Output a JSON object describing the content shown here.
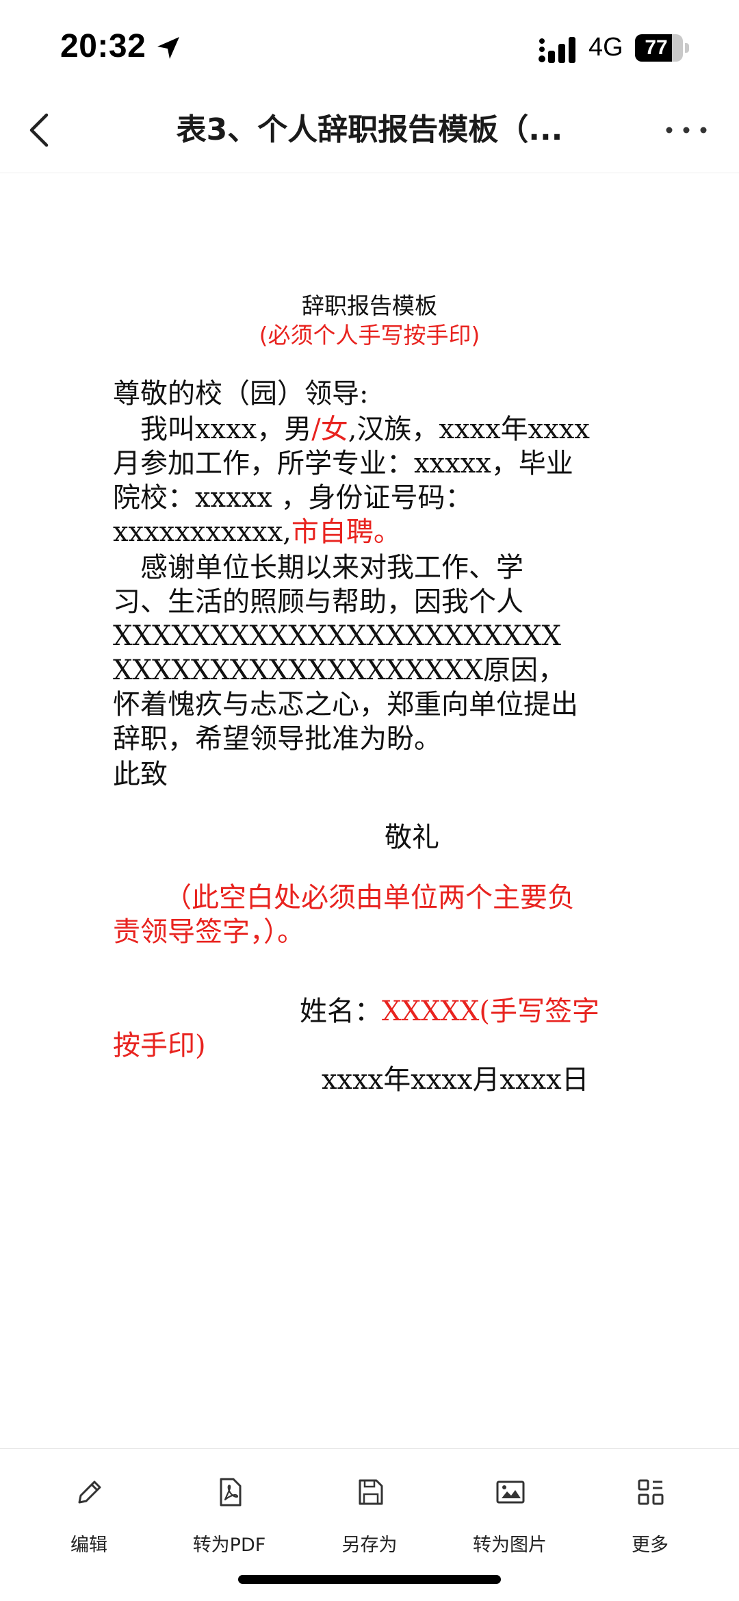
{
  "status_bar": {
    "time": "20:32",
    "network": "4G",
    "battery": "77",
    "battery_fraction": 0.77
  },
  "nav": {
    "title": "表3、个人辞职报告模板（...",
    "back_icon": "chevron-left-icon",
    "more_icon": "ellipsis-icon"
  },
  "document": {
    "title": "辞职报告模板",
    "title_note": "(必须个人手写按手印)",
    "salutation": "尊敬的校（园）领导:",
    "p1_l1_a": "　我叫xxxx，男",
    "p1_l1_b": "/女",
    "p1_l1_c": ",汉族，xxxx年xxxx",
    "p1_l2": "月参加工作，所学专业：xxxxx，毕业",
    "p1_l3": "院校：xxxxx ，身份证号码：",
    "p1_l4_a": "xxxxxxxxxxx,",
    "p1_l4_b": "市自聘。",
    "p2_l1": "　感谢单位长期以来对我工作、学",
    "p2_l2": "习、生活的照顾与帮助，因我个人",
    "p2_l3": "XXXXXXXXXXXXXXXXXXXXXXX",
    "p2_l4": "XXXXXXXXXXXXXXXXXXX原因，",
    "p2_l5": "怀着愧疚与忐忑之心，郑重向单位提出",
    "p2_l6": "辞职，希望领导批准为盼。",
    "closing": "此致",
    "regards": "敬礼",
    "note_l1": "（此空白处必须由单位两个主要负",
    "note_l2": "责领导签字，）。",
    "name_label": "姓名：",
    "name_value": "XXXXX(手写签字",
    "name_value_l2": "按手印)",
    "date": "xxxx年xxxx月xxxx日"
  },
  "toolbar": {
    "items": [
      {
        "label": "编辑",
        "icon": "pencil-icon"
      },
      {
        "label": "转为PDF",
        "icon": "pdf-file-icon"
      },
      {
        "label": "另存为",
        "icon": "save-icon"
      },
      {
        "label": "转为图片",
        "icon": "image-icon"
      },
      {
        "label": "更多",
        "icon": "grid-icon"
      }
    ]
  },
  "colors": {
    "red_text": "#e8231f",
    "body_text": "#111111"
  }
}
